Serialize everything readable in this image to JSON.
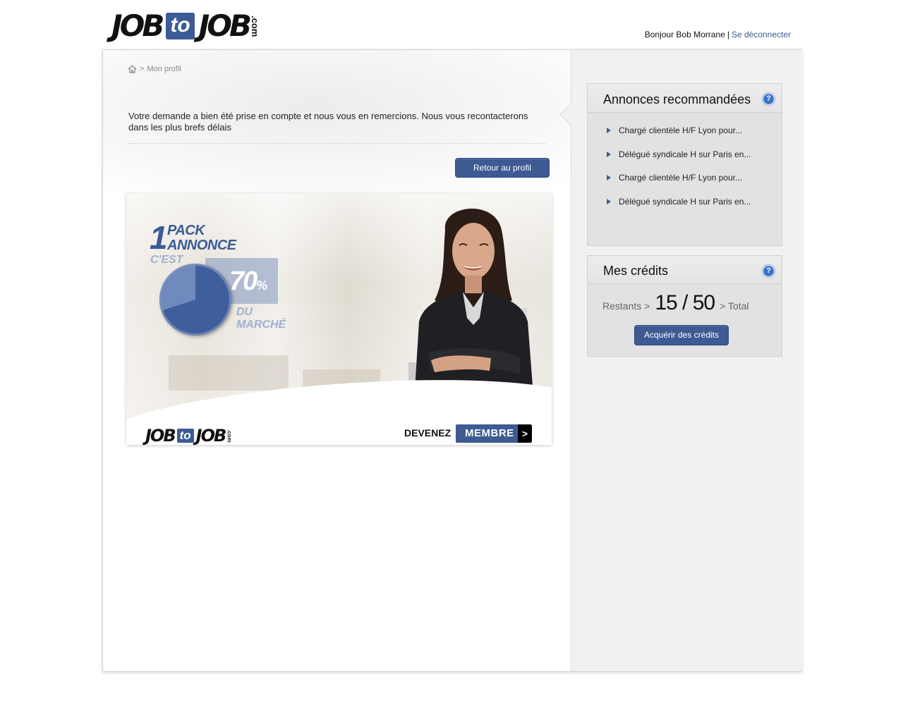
{
  "header": {
    "logo": {
      "job1": "JOB",
      "to": "to",
      "job2": "JOB",
      "com": ".com"
    },
    "greeting": "Bonjour Bob Morrane",
    "separator": "|",
    "logout_label": "Se déconnecter"
  },
  "breadcrumb": {
    "separator": ">",
    "current": "Mon profil"
  },
  "confirmation_message": "Votre demande a bien été prise en compte et nous vous en remercions. Nous vous recontacterons dans les plus brefs délais",
  "back_button_label": "Retour au profil",
  "banner": {
    "pack_number": "1",
    "pack_line1": "PACK",
    "pack_line2": "ANNONCE",
    "cest": "C'EST",
    "percent_value": "70",
    "percent_sign": "%",
    "du": "DU",
    "marche": "MARCHÉ",
    "pie_share": 0.7,
    "devenez": "DEVENEZ",
    "membre": "MEMBRE",
    "arrow": ">"
  },
  "recommended": {
    "title": "Annonces recommandées",
    "help": "?",
    "items": [
      "Chargé clientèle H/F Lyon pour...",
      "Délégué syndicale H sur Paris en...",
      "Chargé clientèle H/F Lyon pour...",
      "Délégué syndicale H sur Paris en..."
    ]
  },
  "credits": {
    "title": "Mes crédits",
    "help": "?",
    "remaining_label": "Restants >",
    "value": "15 / 50",
    "total_label": "> Total",
    "buy_button_label": "Acquérir des crédits"
  },
  "colors": {
    "brand_blue": "#3a5b95",
    "button_blue": "#3e5a93",
    "help_blue": "#3a74c8"
  }
}
